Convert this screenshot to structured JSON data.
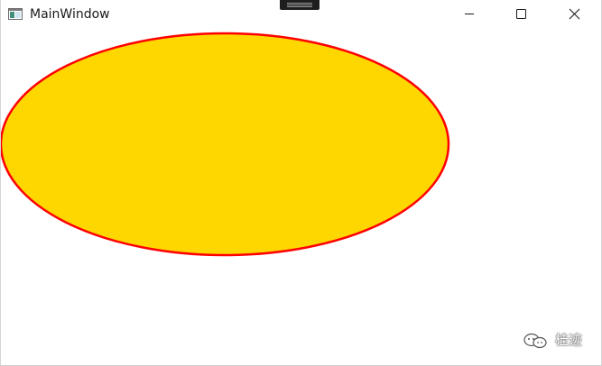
{
  "window": {
    "title": "MainWindow",
    "icon": "wpf-window-icon"
  },
  "caption_buttons": {
    "minimize_icon": "minimize-icon",
    "maximize_icon": "maximize-icon",
    "close_icon": "close-icon"
  },
  "shape": {
    "type": "ellipse",
    "fill": "#FFD700",
    "stroke": "#FF0000"
  },
  "watermark": {
    "icon": "wechat-icon",
    "text": "桂迹"
  }
}
